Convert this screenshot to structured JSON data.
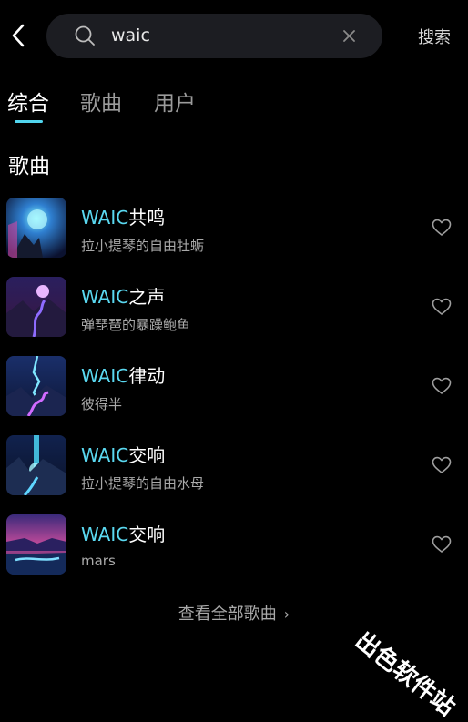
{
  "search": {
    "value": "waic",
    "button_label": "搜索"
  },
  "tabs": [
    {
      "label": "综合",
      "active": true
    },
    {
      "label": "歌曲",
      "active": false
    },
    {
      "label": "用户",
      "active": false
    }
  ],
  "section_title": "歌曲",
  "songs": [
    {
      "title_highlight": "WAIC",
      "title_rest": "共鸣",
      "artist": "拉小提琴的自由牡蛎"
    },
    {
      "title_highlight": "WAIC",
      "title_rest": "之声",
      "artist": "弹琵琶的暴躁鲍鱼"
    },
    {
      "title_highlight": "WAIC",
      "title_rest": "律动",
      "artist": "彼得半"
    },
    {
      "title_highlight": "WAIC",
      "title_rest": "交响",
      "artist": "拉小提琴的自由水母"
    },
    {
      "title_highlight": "WAIC",
      "title_rest": "交响",
      "artist": "mars"
    }
  ],
  "view_all_label": "查看全部歌曲",
  "watermark": "出色软件站",
  "colors": {
    "accent": "#5ad8f0",
    "background": "#000000",
    "search_bg": "#1c1d22"
  },
  "icons": [
    "back-arrow-icon",
    "search-icon",
    "clear-icon",
    "heart-icon",
    "chevron-right-icon"
  ]
}
